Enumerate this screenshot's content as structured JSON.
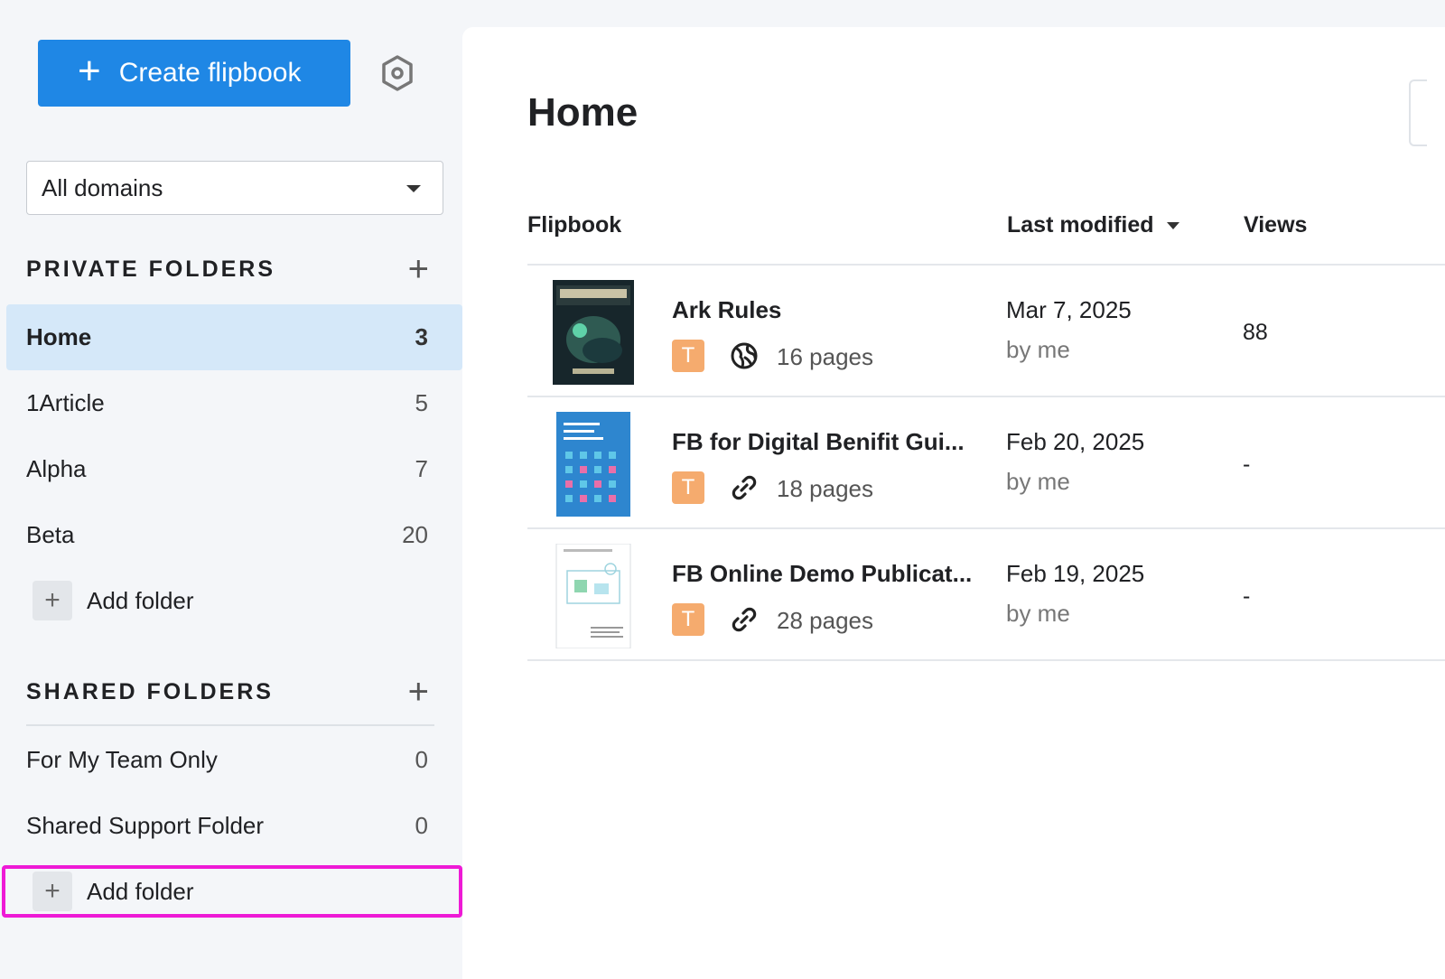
{
  "sidebar": {
    "create_label": "Create flipbook",
    "domain_select": "All domains",
    "private_title": "PRIVATE FOLDERS",
    "private_folders": [
      {
        "label": "Home",
        "count": "3"
      },
      {
        "label": "1Article",
        "count": "5"
      },
      {
        "label": "Alpha",
        "count": "7"
      },
      {
        "label": "Beta",
        "count": "20"
      }
    ],
    "add_folder_label": "Add folder",
    "shared_title": "SHARED FOLDERS",
    "shared_folders": [
      {
        "label": "For My Team Only",
        "count": "0"
      },
      {
        "label": "Shared Support Folder",
        "count": "0"
      }
    ]
  },
  "main": {
    "title": "Home",
    "columns": {
      "flipbook": "Flipbook",
      "last_modified": "Last modified",
      "views": "Views"
    },
    "rows": [
      {
        "name": "Ark Rules",
        "badge": "T",
        "link_type": "globe-icon",
        "pages": "16 pages",
        "date": "Mar 7, 2025",
        "by": "by me",
        "views": "88"
      },
      {
        "name": "FB for Digital Benifit Gui...",
        "badge": "T",
        "link_type": "link-icon",
        "pages": "18 pages",
        "date": "Feb 20, 2025",
        "by": "by me",
        "views": "-"
      },
      {
        "name": "FB Online Demo Publicat...",
        "badge": "T",
        "link_type": "link-icon",
        "pages": "28 pages",
        "date": "Feb 19, 2025",
        "by": "by me",
        "views": "-"
      }
    ]
  },
  "colors": {
    "accent": "#1f87e5",
    "active_folder": "#d5e8f9",
    "badge": "#f5ab6e",
    "highlight": "#ee1ad6"
  }
}
